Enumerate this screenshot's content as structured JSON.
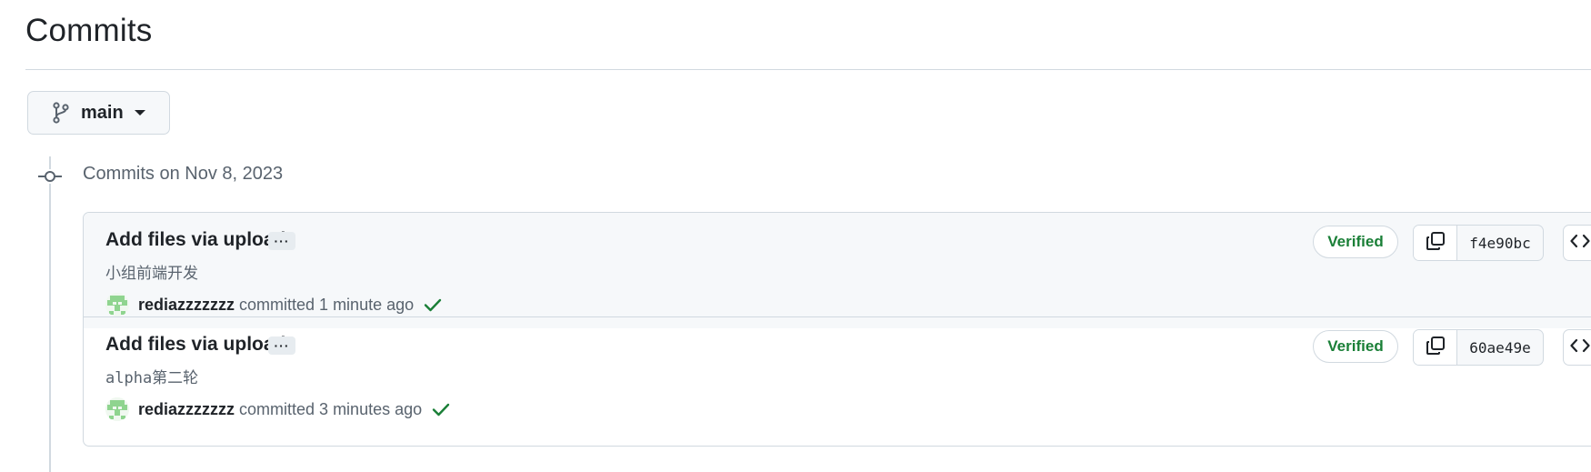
{
  "page": {
    "title": "Commits"
  },
  "branch": {
    "name": "main",
    "icon": "git-branch-icon"
  },
  "group": {
    "heading": "Commits on Nov 8, 2023"
  },
  "colors": {
    "verified": "#1a7f37",
    "check": "#1a7f37",
    "border": "#d1d9e0",
    "muted": "#59636e",
    "hover_bg": "#f6f8fa"
  },
  "commits": [
    {
      "title": "Add files via upload",
      "ellipsis": "···",
      "description": "小组前端开发",
      "author": "rediazzzzzzz",
      "committed_text": "committed 1 minute ago",
      "badge": "Verified",
      "sha": "f4e90bc",
      "status_icon": "check-icon"
    },
    {
      "title": "Add files via upload",
      "ellipsis": "···",
      "description": "alpha第二轮",
      "author": "rediazzzzzzz",
      "committed_text": "committed 3 minutes ago",
      "badge": "Verified",
      "sha": "60ae49e",
      "status_icon": "check-icon"
    }
  ]
}
